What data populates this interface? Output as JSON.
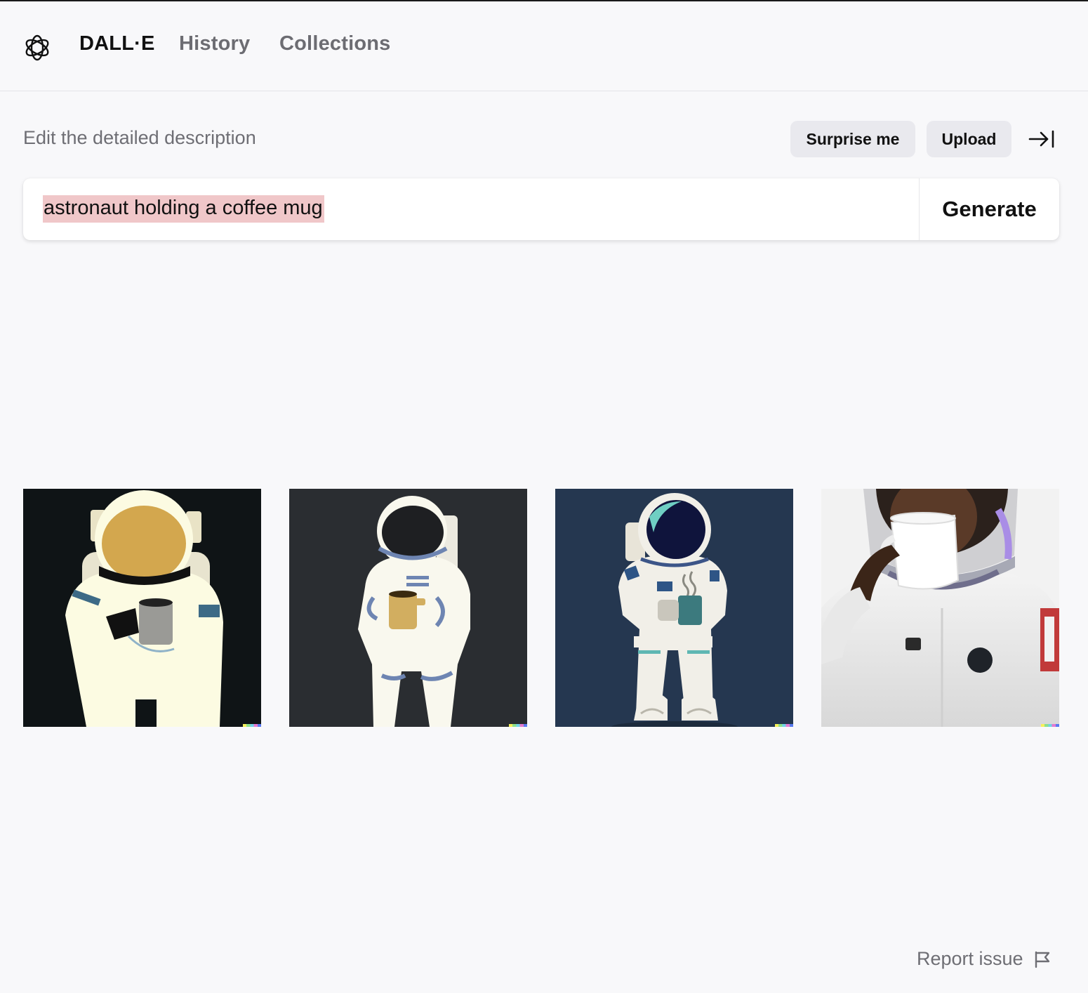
{
  "header": {
    "brand": "DALL·E",
    "nav": [
      {
        "label": "History"
      },
      {
        "label": "Collections"
      }
    ]
  },
  "editor": {
    "description_label": "Edit the detailed description",
    "surprise_label": "Surprise me",
    "upload_label": "Upload",
    "prompt_value": "astronaut holding a coffee mug",
    "generate_label": "Generate"
  },
  "results": {
    "images": [
      {
        "icon": "astronaut-gold-visor-image",
        "background": "#0f1416"
      },
      {
        "icon": "astronaut-black-visor-image",
        "background": "#2a2d31"
      },
      {
        "icon": "astronaut-steaming-mug-image",
        "background": "#253750"
      },
      {
        "icon": "astronaut-photo-drinking-image",
        "background": "#f2f2f2"
      }
    ]
  },
  "footer": {
    "report_label": "Report issue"
  },
  "colors": {
    "prompt_highlight": "#f0c7c9",
    "pill_background": "#e9e9ee",
    "page_background": "#f8f8fa"
  }
}
